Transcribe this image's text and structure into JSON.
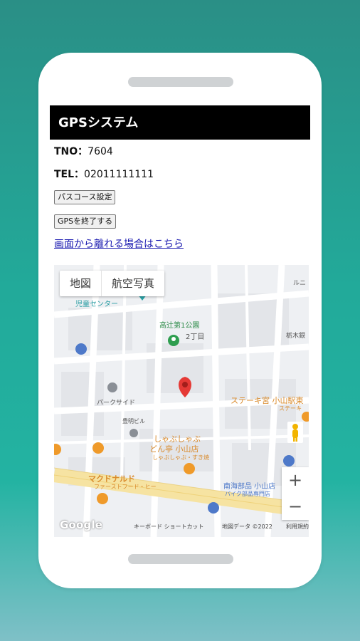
{
  "app": {
    "title": "GPSシステム",
    "tno_label": "TNO：",
    "tno_value": "7604",
    "tel_label": "TEL：",
    "tel_value": "02011111111",
    "passcourse_button": "パスコース設定",
    "end_gps_button": "GPSを終了する",
    "leave_link": "画面から離れる場合はこちら"
  },
  "map": {
    "type_tabs": [
      "地図",
      "航空写真"
    ],
    "labels": {
      "children_center": "児童センター",
      "park_name": "高辻第1公園",
      "park_sub": "2丁目",
      "parkside": "パークサイド",
      "bldg": "豊明ビル",
      "steak": "ステーキ宮 小山駅東",
      "steak_sub": "ステーキ",
      "shabu1": "しゃぶしゃぶ",
      "shabu2": "どん亭 小山店",
      "shabu3": "しゃぶしゃぶ・すき焼",
      "mcd": "マクドナルド",
      "mcd_sub": "ファーストフード・ヒー",
      "bike1": "南海部品 小山店",
      "bike2": "バイク部品専門店",
      "top_right": "ルニ",
      "right_label": "栃木銀"
    },
    "zoom_in": "+",
    "zoom_out": "−",
    "logo": "Google",
    "shortcuts": "キーボード ショートカット",
    "map_data": "地図データ ©2022",
    "terms": "利用規約"
  }
}
